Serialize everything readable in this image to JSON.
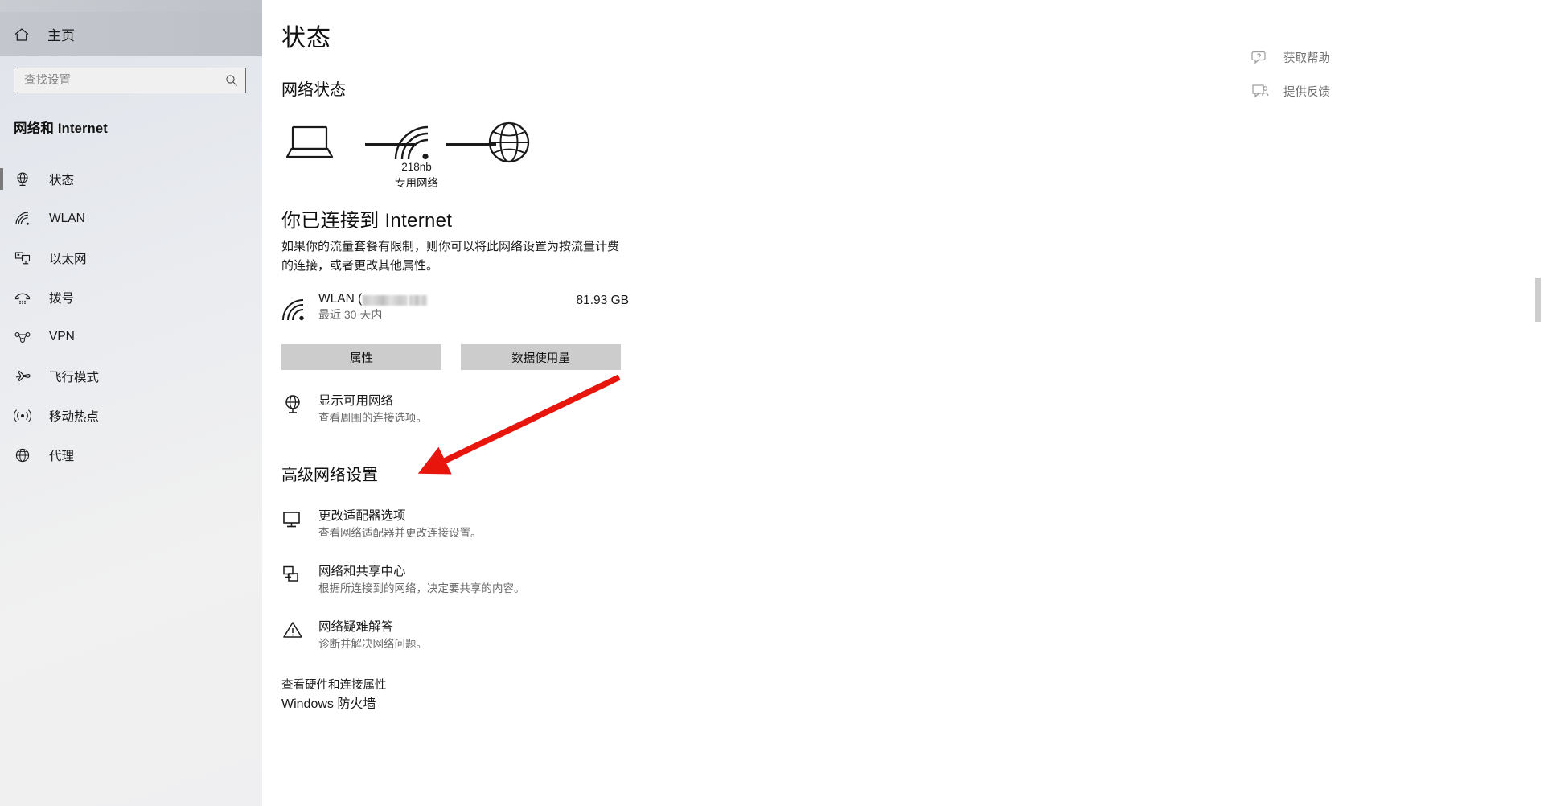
{
  "sidebar": {
    "home_label": "主页",
    "search": {
      "value": "",
      "placeholder": "查找设置"
    },
    "category_title": "网络和 Internet",
    "items": [
      {
        "label": "状态",
        "icon": "globe-monitor-icon",
        "selected": true
      },
      {
        "label": "WLAN",
        "icon": "wifi-icon",
        "selected": false
      },
      {
        "label": "以太网",
        "icon": "ethernet-icon",
        "selected": false
      },
      {
        "label": "拨号",
        "icon": "dialup-phone-icon",
        "selected": false
      },
      {
        "label": "VPN",
        "icon": "vpn-icon",
        "selected": false
      },
      {
        "label": "飞行模式",
        "icon": "airplane-icon",
        "selected": false
      },
      {
        "label": "移动热点",
        "icon": "hotspot-icon",
        "selected": false
      },
      {
        "label": "代理",
        "icon": "proxy-globe-icon",
        "selected": false
      }
    ]
  },
  "main": {
    "page_title": "状态",
    "section_title": "网络状态",
    "diagram": {
      "device_icon": "laptop-icon",
      "router_icon": "wifi-icon",
      "internet_icon": "globe-icon",
      "network_name": "218nb",
      "network_type": "专用网络"
    },
    "connection": {
      "title": "你已连接到 Internet",
      "description": "如果你的流量套餐有限制，则你可以将此网络设置为按流量计费的连接，或者更改其他属性。"
    },
    "wlan": {
      "name_prefix": "WLAN (",
      "period": "最近 30 天内",
      "data_used": "81.93 GB"
    },
    "buttons": {
      "properties": "属性",
      "data_usage": "数据使用量"
    },
    "show_networks": {
      "title": "显示可用网络",
      "subtitle": "查看周围的连接选项。"
    },
    "advanced_title": "高级网络设置",
    "advanced_links": [
      {
        "title": "更改适配器选项",
        "subtitle": "查看网络适配器并更改连接设置。",
        "icon": "monitor-icon"
      },
      {
        "title": "网络和共享中心",
        "subtitle": "根据所连接到的网络，决定要共享的内容。",
        "icon": "sharing-icon"
      },
      {
        "title": "网络疑难解答",
        "subtitle": "诊断并解决网络问题。",
        "icon": "warning-triangle-icon"
      }
    ],
    "hardware_link": "查看硬件和连接属性",
    "firewall_title": "Windows 防火墙"
  },
  "help_panel": {
    "items": [
      {
        "label": "获取帮助",
        "icon": "question-help-icon"
      },
      {
        "label": "提供反馈",
        "icon": "feedback-icon"
      }
    ]
  },
  "annotation": {
    "arrow_color": "#e8150d"
  }
}
